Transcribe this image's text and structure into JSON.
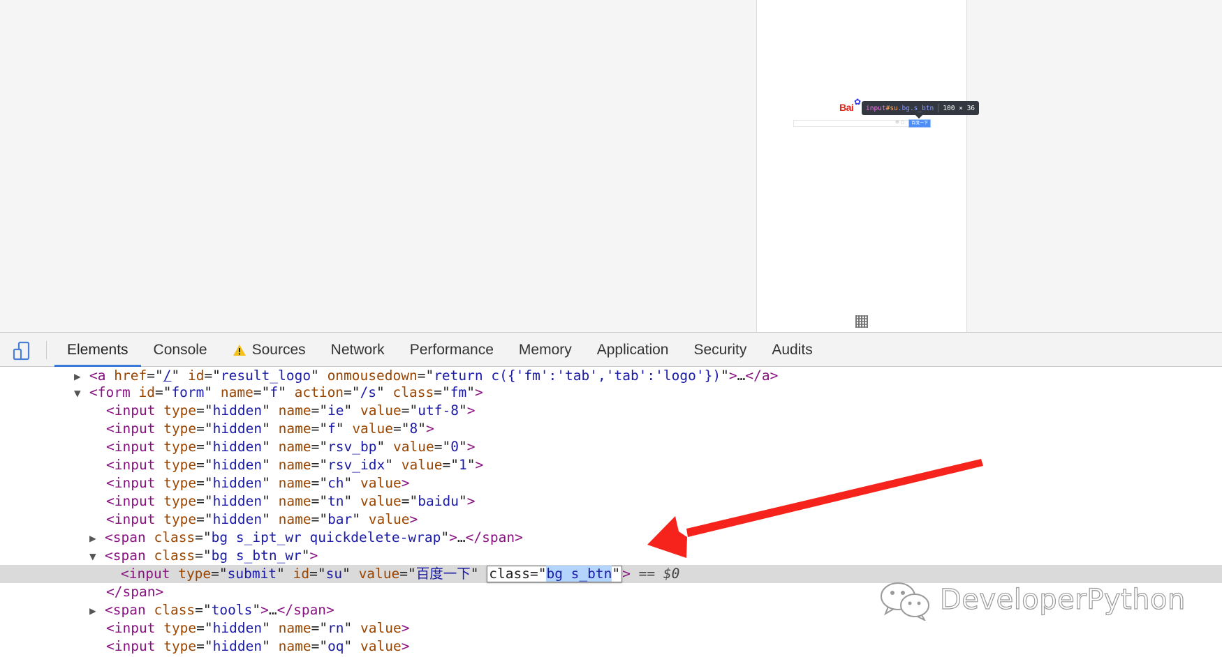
{
  "viewport": {
    "logo_text": "Bai",
    "tooltip": {
      "tag": "input",
      "id": "#su",
      "classes": ".bg.s_btn",
      "size": "100 × 36"
    },
    "search_icons": "⊕ ◻",
    "search_button_label": "百度一下"
  },
  "toolbar": {
    "tabs": [
      {
        "label": "Elements"
      },
      {
        "label": "Console"
      },
      {
        "label": "Sources"
      },
      {
        "label": "Network"
      },
      {
        "label": "Performance"
      },
      {
        "label": "Memory"
      },
      {
        "label": "Application"
      },
      {
        "label": "Security"
      },
      {
        "label": "Audits"
      }
    ]
  },
  "elements": {
    "line0": {
      "tag": "a",
      "a1": "href",
      "v1": "/",
      "a2": "id",
      "v2": "result_logo",
      "a3": "onmousedown",
      "v3": "return c({'fm':'tab','tab':'logo'})",
      "ellipsis": "…",
      "close": "</a>"
    },
    "line1": {
      "tag": "form",
      "a1": "id",
      "v1": "form",
      "a2": "name",
      "v2": "f",
      "a3": "action",
      "v3": "/s",
      "a4": "class",
      "v4": "fm"
    },
    "line2": {
      "a1": "type",
      "v1": "hidden",
      "a2": "name",
      "v2": "ie",
      "a3": "value",
      "v3": "utf-8"
    },
    "line3": {
      "a1": "type",
      "v1": "hidden",
      "a2": "name",
      "v2": "f",
      "a3": "value",
      "v3": "8"
    },
    "line4": {
      "a1": "type",
      "v1": "hidden",
      "a2": "name",
      "v2": "rsv_bp",
      "a3": "value",
      "v3": "0"
    },
    "line5": {
      "a1": "type",
      "v1": "hidden",
      "a2": "name",
      "v2": "rsv_idx",
      "a3": "value",
      "v3": "1"
    },
    "line6": {
      "a1": "type",
      "v1": "hidden",
      "a2": "name",
      "v2": "ch",
      "a3": "value"
    },
    "line7": {
      "a1": "type",
      "v1": "hidden",
      "a2": "name",
      "v2": "tn",
      "a3": "value",
      "v3": "baidu"
    },
    "line8": {
      "a1": "type",
      "v1": "hidden",
      "a2": "name",
      "v2": "bar",
      "a3": "value"
    },
    "line9": {
      "tag": "span",
      "a1": "class",
      "v1": "bg s_ipt_wr quickdelete-wrap",
      "ellipsis": "…",
      "close": "</span>"
    },
    "line10": {
      "tag": "span",
      "a1": "class",
      "v1": "bg s_btn_wr"
    },
    "line11": {
      "tag": "input",
      "a1": "type",
      "v1": "submit",
      "a2": "id",
      "v2": "su",
      "a3": "value",
      "v3": "百度一下",
      "edit_attr": "class",
      "edit_value": "bg s_btn",
      "eq": "== ",
      "dollar": "$0"
    },
    "line12": {
      "close": "</span>"
    },
    "line13": {
      "tag": "span",
      "a1": "class",
      "v1": "tools",
      "ellipsis": "…",
      "close": "</span>"
    },
    "line14": {
      "a1": "type",
      "v1": "hidden",
      "a2": "name",
      "v2": "rn",
      "a3": "value"
    },
    "line15": {
      "a1": "type",
      "v1": "hidden",
      "a2": "name",
      "v2": "oq",
      "a3": "value"
    }
  },
  "watermark": {
    "text": "DeveloperPython"
  },
  "colors": {
    "tag": "#881280",
    "attr": "#994500",
    "value": "#1a1aa6",
    "arrow": "#f5231b",
    "active_tab": "#3879d9"
  }
}
